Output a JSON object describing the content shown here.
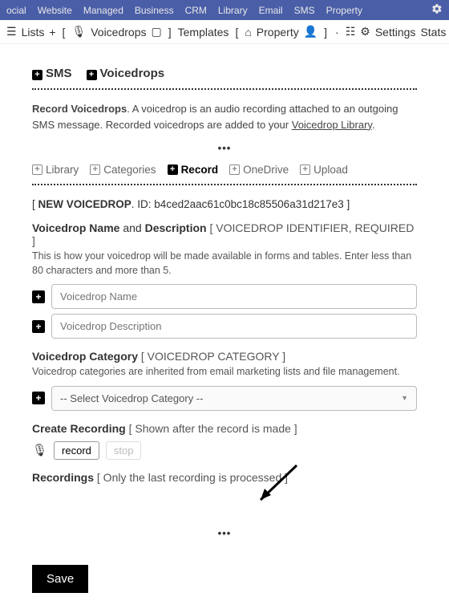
{
  "topnav": {
    "items": [
      "ocial",
      "Website",
      "Managed",
      "Business",
      "CRM",
      "Library",
      "Email",
      "SMS",
      "Property"
    ]
  },
  "subnav": {
    "lists": "Lists",
    "voicedrops": "Voicedrops",
    "templates": "Templates",
    "property": "Property",
    "settings": "Settings",
    "stats": "Stats"
  },
  "header": {
    "sms": "SMS",
    "voicedrops": "Voicedrops"
  },
  "intro": {
    "lead": "Record Voicedrops",
    "body": ". A voicedrop is an audio recording attached to an outgoing SMS message. Recorded voicedrops are added to your ",
    "link": "Voicedrop Library"
  },
  "tabs": {
    "library": "Library",
    "categories": "Categories",
    "record": "Record",
    "onedrive": "OneDrive",
    "upload": "Upload"
  },
  "newline": {
    "label": "NEW VOICEDROP",
    "idlabel": ". ID: ",
    "id": "b4ced2aac61c0bc18c85506a31d217e3"
  },
  "name_section": {
    "title_a": "Voicedrop Name",
    "title_mid": " and ",
    "title_b": "Description",
    "bracket": "[ VOICEDROP IDENTIFIER, REQUIRED ]",
    "help": "This is how your voicedrop will be made available in forms and tables. Enter less than 80 characters and more than 5.",
    "name_placeholder": "Voicedrop Name",
    "desc_placeholder": "Voicedrop Description"
  },
  "cat_section": {
    "title": "Voicedrop Category",
    "bracket": "[ VOICEDROP CATEGORY ]",
    "help": "Voicedrop categories are inherited from email marketing lists and file management.",
    "placeholder": "-- Select Voicedrop Category --"
  },
  "rec_section": {
    "title": "Create Recording",
    "bracket": "[ Shown after the record is made ]",
    "record": "record",
    "stop": "stop"
  },
  "recordings": {
    "title": "Recordings",
    "bracket": "[ Only the last recording is processed ]"
  },
  "save": "Save"
}
